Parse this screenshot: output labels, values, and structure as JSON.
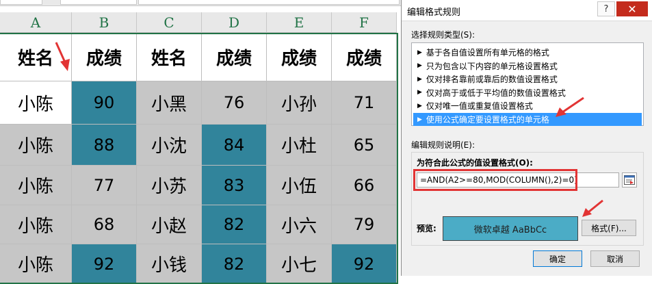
{
  "spreadsheet": {
    "columns": [
      "A",
      "B",
      "C",
      "D",
      "E",
      "F"
    ],
    "rows": [
      [
        {
          "t": "姓名",
          "c": "white",
          "k": "hdr"
        },
        {
          "t": "成绩",
          "c": "white",
          "k": "hdr"
        },
        {
          "t": "姓名",
          "c": "white",
          "k": "hdr"
        },
        {
          "t": "成绩",
          "c": "white",
          "k": "hdr"
        },
        {
          "t": "成绩",
          "c": "white",
          "k": "hdr"
        },
        {
          "t": "成绩",
          "c": "white",
          "k": "hdr"
        }
      ],
      [
        {
          "t": "小陈",
          "c": "white",
          "k": "name"
        },
        {
          "t": "90",
          "c": "teal",
          "k": "num"
        },
        {
          "t": "小黑",
          "c": "gray",
          "k": "name"
        },
        {
          "t": "76",
          "c": "gray",
          "k": "num"
        },
        {
          "t": "小孙",
          "c": "gray",
          "k": "name"
        },
        {
          "t": "71",
          "c": "gray",
          "k": "num"
        }
      ],
      [
        {
          "t": "小陈",
          "c": "gray",
          "k": "name"
        },
        {
          "t": "88",
          "c": "teal",
          "k": "num"
        },
        {
          "t": "小沈",
          "c": "gray",
          "k": "name"
        },
        {
          "t": "84",
          "c": "teal",
          "k": "num"
        },
        {
          "t": "小杜",
          "c": "gray",
          "k": "name"
        },
        {
          "t": "65",
          "c": "gray",
          "k": "num"
        }
      ],
      [
        {
          "t": "小陈",
          "c": "gray",
          "k": "name"
        },
        {
          "t": "77",
          "c": "gray",
          "k": "num"
        },
        {
          "t": "小苏",
          "c": "gray",
          "k": "name"
        },
        {
          "t": "83",
          "c": "teal",
          "k": "num"
        },
        {
          "t": "小伍",
          "c": "gray",
          "k": "name"
        },
        {
          "t": "66",
          "c": "gray",
          "k": "num"
        }
      ],
      [
        {
          "t": "小陈",
          "c": "gray",
          "k": "name"
        },
        {
          "t": "68",
          "c": "gray",
          "k": "num"
        },
        {
          "t": "小赵",
          "c": "gray",
          "k": "name"
        },
        {
          "t": "82",
          "c": "teal",
          "k": "num"
        },
        {
          "t": "小六",
          "c": "gray",
          "k": "name"
        },
        {
          "t": "79",
          "c": "gray",
          "k": "num"
        }
      ],
      [
        {
          "t": "小陈",
          "c": "gray",
          "k": "name"
        },
        {
          "t": "92",
          "c": "teal",
          "k": "num"
        },
        {
          "t": "小钱",
          "c": "gray",
          "k": "name"
        },
        {
          "t": "82",
          "c": "teal",
          "k": "num"
        },
        {
          "t": "小七",
          "c": "gray",
          "k": "name"
        },
        {
          "t": "92",
          "c": "teal",
          "k": "num"
        }
      ]
    ]
  },
  "dialog": {
    "title": "编辑格式规则",
    "help_label": "?",
    "close_label": "✕",
    "rule_type_label": "选择规则类型(S):",
    "rule_types": [
      "基于各自值设置所有单元格的格式",
      "只为包含以下内容的单元格设置格式",
      "仅对排名靠前或靠后的数值设置格式",
      "仅对高于或低于平均值的数值设置格式",
      "仅对唯一值或重复值设置格式",
      "使用公式确定要设置格式的单元格"
    ],
    "selected_rule_index": 5,
    "edit_desc_label": "编辑规则说明(E):",
    "formula_label": "为符合此公式的值设置格式(O):",
    "formula_value": "=AND(A2>=80,MOD(COLUMN(),2)=0)",
    "preview_label": "预览:",
    "preview_text": "微软卓越  AaBbCc",
    "format_button": "格式(F)...",
    "ok_button": "确定",
    "cancel_button": "取消"
  },
  "colors": {
    "teal": "#31849b",
    "gray": "#c6c6c6",
    "preview": "#4bacc6",
    "highlight_red": "#e23434",
    "selection": "#3399ff"
  }
}
